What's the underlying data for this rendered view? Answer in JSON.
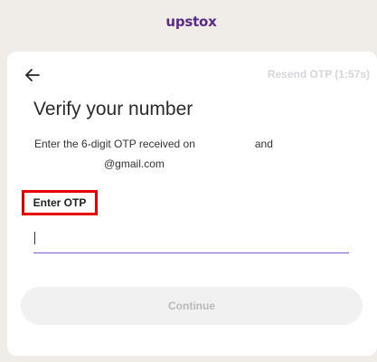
{
  "header": {
    "logo_text": "upstox",
    "logo_icon": "upstox-logo-icon"
  },
  "card": {
    "back_icon": "arrow-left-icon",
    "resend_label": "Resend OTP (1:57s)",
    "title": "Verify your number",
    "description": {
      "part1": "Enter the 6-digit OTP received on",
      "part2": "and",
      "part3": "@gmail.com"
    },
    "otp_label": "Enter OTP",
    "otp_value": "",
    "continue_label": "Continue"
  },
  "colors": {
    "brand": "#5a2a88",
    "input_underline": "#7b5ad6",
    "highlight_box": "#e60000"
  }
}
